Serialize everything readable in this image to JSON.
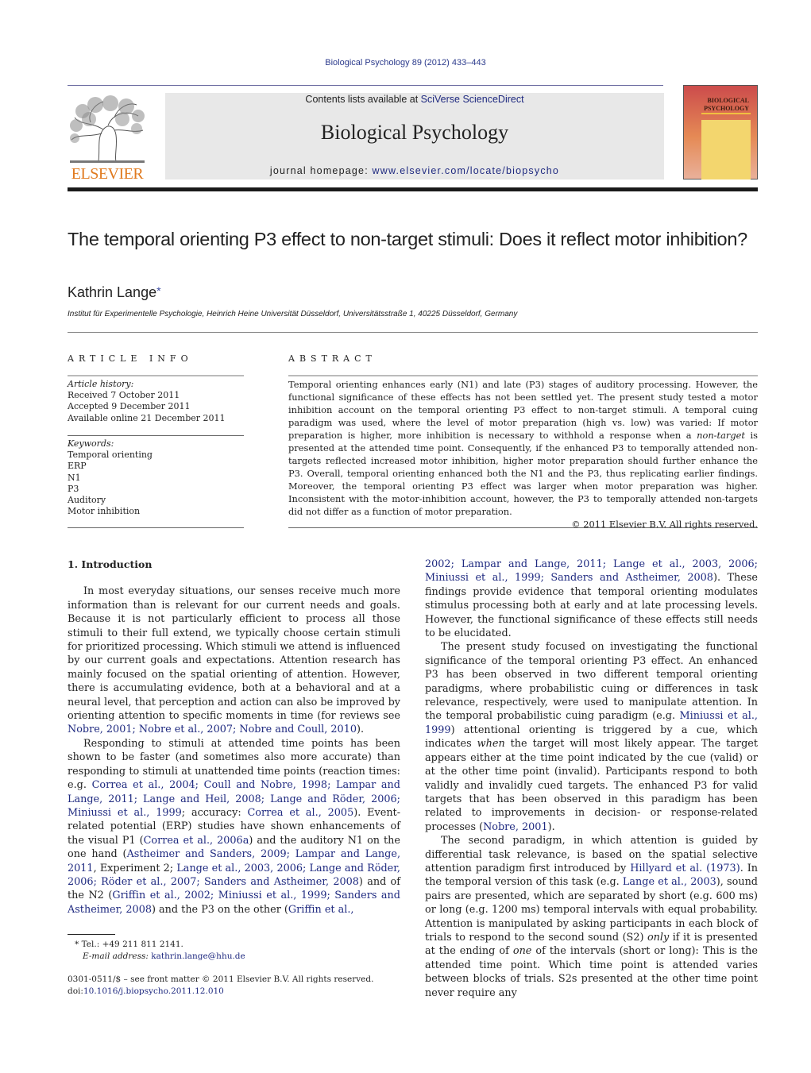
{
  "header": {
    "journal_ref": "Biological Psychology 89 (2012) 433–443",
    "contents_prefix": "Contents lists available at ",
    "contents_link": "SciVerse ScienceDirect",
    "journal_name": "Biological Psychology",
    "homepage_prefix": "journal homepage: ",
    "homepage_link": "www.elsevier.com/locate/biopsycho",
    "publisher": "ELSEVIER",
    "cover_title_1": "BIOLOGICAL",
    "cover_title_2": "PSYCHOLOGY"
  },
  "article": {
    "title": "The temporal orienting P3 effect to non-target stimuli: Does it reflect motor inhibition?",
    "author": "Kathrin Lange",
    "author_mark": "*",
    "affiliation": "Institut für Experimentelle Psychologie, Heinrich Heine Universität Düsseldorf, Universitätsstraße 1, 40225 Düsseldorf, Germany"
  },
  "article_info": {
    "heading": "ARTICLE INFO",
    "history_label": "Article history:",
    "history": [
      "Received 7 October 2011",
      "Accepted 9 December 2011",
      "Available online 21 December 2011"
    ],
    "keywords_label": "Keywords:",
    "keywords": [
      "Temporal orienting",
      "ERP",
      "N1",
      "P3",
      "Auditory",
      "Motor inhibition"
    ]
  },
  "abstract": {
    "heading": "ABSTRACT",
    "text_1": "Temporal orienting enhances early (N1) and late (P3) stages of auditory processing. However, the functional significance of these effects has not been settled yet. The present study tested a motor inhibition account on the temporal orienting P3 effect to non-target stimuli. A temporal cuing paradigm was used, where the level of motor preparation (high vs. low) was varied: If motor preparation is higher, more inhibition is necessary to withhold a response when a ",
    "text_italic": "non-target",
    "text_2": " is presented at the attended time point. Consequently, if the enhanced P3 to temporally attended non-targets reflected increased motor inhibition, higher motor preparation should further enhance the P3. Overall, temporal orienting enhanced both the N1 and the P3, thus replicating earlier findings. Moreover, the temporal orienting P3 effect was larger when motor preparation was higher. Inconsistent with the motor-inhibition account, however, the P3 to temporally attended non-targets did not differ as a function of motor preparation.",
    "copyright": "© 2011 Elsevier B.V. All rights reserved."
  },
  "intro": {
    "heading": "1.  Introduction",
    "p1_text": "In most everyday situations, our senses receive much more information than is relevant for our current needs and goals. Because it is not particularly efficient to process all those stimuli to their full extend, we typically choose certain stimuli for prioritized processing. Which stimuli we attend is influenced by our current goals and expectations. Attention research has mainly focused on the spatial orienting of attention. However, there is accumulating evidence, both at a behavioral and at a neural level, that perception and action can also be improved by orienting attention to specific moments in time (for reviews see ",
    "p1_refs": "Nobre, 2001; Nobre et al., 2007; Nobre and Coull, 2010",
    "p1_end": ").",
    "p2_a": "Responding to stimuli at attended time points has been shown to be faster (and sometimes also more accurate) than responding to stimuli at unattended time points (reaction times: e.g. ",
    "p2_refs1": "Correa et al., 2004; Coull and Nobre, 1998; Lampar and Lange, 2011; Lange and Heil, 2008; Lange and Röder, 2006; Miniussi et al., 1999",
    "p2_b": "; accuracy: ",
    "p2_refs2": "Correa et al., 2005",
    "p2_c": "). Event-related potential (ERP) studies have shown enhancements of the visual P1 (",
    "p2_refs3": "Correa et al., 2006a",
    "p2_d": ") and the auditory N1 on the one hand (",
    "p2_refs4": "Astheimer and Sanders, 2009; Lampar and Lange, 2011",
    "p2_e": ", Experiment 2; ",
    "p2_refs5": "Lange et al., 2003, 2006; Lange and Röder, 2006; Röder et al., 2007; Sanders and Astheimer, 2008",
    "p2_f": ") and of the N2 (",
    "p2_refs6": "Griffin et al., 2002; Miniussi et al., 1999; Sanders and Astheimer, 2008",
    "p2_g": ") and the P3 on the other (",
    "p2_refs7": "Griffin et al., 2002; Lampar and Lange, 2011; Lange et al., 2003, 2006; Miniussi et al., 1999; Sanders and Astheimer, 2008",
    "p2_h": "). These findings provide evidence that temporal orienting modulates stimulus processing both at early and at late processing levels. However, the functional significance of these effects still needs to be elucidated.",
    "p3_a": "The present study focused on investigating the functional significance of the temporal orienting P3 effect. An enhanced P3 has been observed in two different temporal orienting paradigms, where probabilistic cuing or differences in task relevance, respectively, were used to manipulate attention. In the temporal probabilistic cuing paradigm (e.g. ",
    "p3_refs1": "Miniussi et al., 1999",
    "p3_b": ") attentional orienting is triggered by a cue, which indicates ",
    "p3_italic": "when",
    "p3_c": " the target will most likely appear. The target appears either at the time point indicated by the cue (valid) or at the other time point (invalid). Participants respond to both validly and invalidly cued targets. The enhanced P3 for valid targets that has been observed in this paradigm has been related to improvements in decision- or response-related processes (",
    "p3_refs2": "Nobre, 2001",
    "p3_d": ").",
    "p4_a": "The second paradigm, in which attention is guided by differential task relevance, is based on the spatial selective attention paradigm first introduced by ",
    "p4_refs1": "Hillyard et al. (1973)",
    "p4_b": ". In the temporal version of this task (e.g. ",
    "p4_refs2": "Lange et al., 2003",
    "p4_c": "), sound pairs are presented, which are separated by short (e.g. 600 ms) or long (e.g. 1200 ms) temporal intervals with equal probability. Attention is manipulated by asking participants in each block of trials to respond to the second sound (S2) ",
    "p4_it1": "only",
    "p4_d": " if it is presented at the ending of ",
    "p4_it2": "one",
    "p4_e": " of the intervals (short or long): This is the attended time point. Which time point is attended varies between blocks of trials. S2s presented at the other time point never require any"
  },
  "footnote": {
    "mark": "*",
    "tel": "Tel.: +49 211 811 2141.",
    "email_label": "E-mail address:",
    "email": "kathrin.lange@hhu.de"
  },
  "front_matter": {
    "issn_line": "0301-0511/$ – see front matter © 2011 Elsevier B.V. All rights reserved.",
    "doi_prefix": "doi:",
    "doi": "10.1016/j.biopsycho.2011.12.010"
  }
}
